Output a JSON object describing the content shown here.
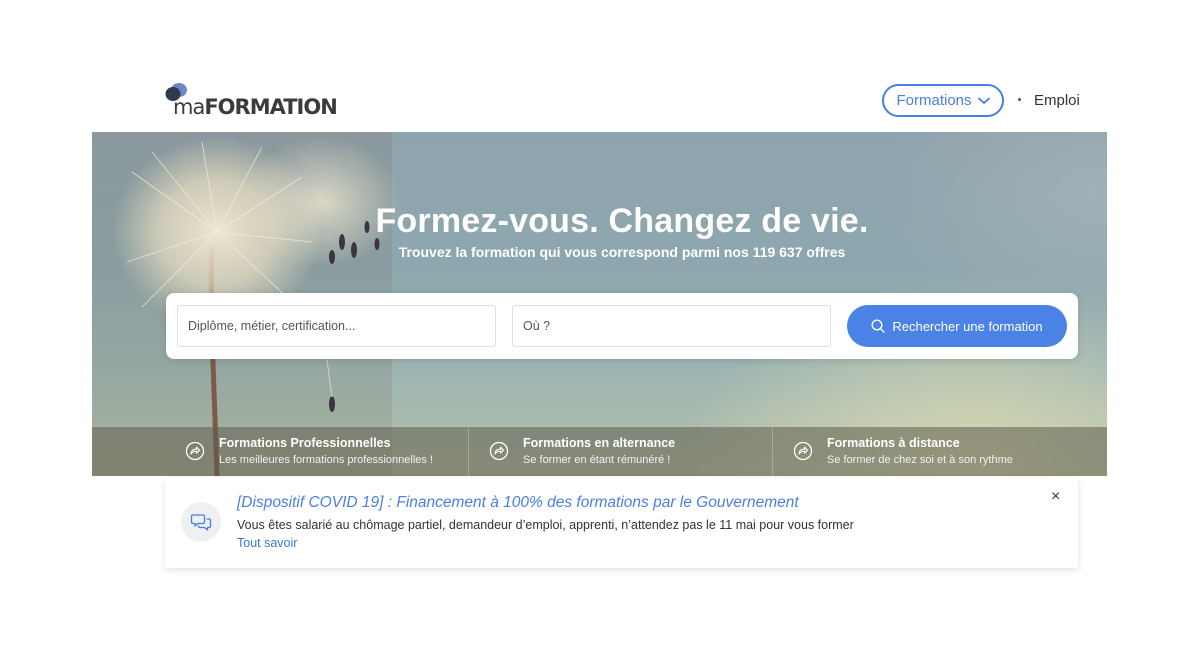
{
  "header": {
    "logo": {
      "prefix": "ma",
      "word": "FORMATION"
    },
    "nav": {
      "formations_label": "Formations",
      "emploi_label": "Emploi"
    }
  },
  "hero": {
    "title": "Formez-vous. Changez de vie.",
    "subtitle": "Trouvez la formation qui vous correspond parmi nos 119 637 offres"
  },
  "search": {
    "what_placeholder": "Diplôme, métier, certification...",
    "where_placeholder": "Où ?",
    "button_label": "Rechercher une formation",
    "button_color": "#4a82e6"
  },
  "categories": [
    {
      "title": "Formations Professionnelles",
      "subtitle": "Les meilleures formations professionnelles !",
      "icon": "share-arrow-icon"
    },
    {
      "title": "Formations en alternance",
      "subtitle": "Se former en étant rémunéré !",
      "icon": "share-arrow-icon"
    },
    {
      "title": "Formations à distance",
      "subtitle": "Se former de chez soi et à son rythme",
      "icon": "share-arrow-icon"
    }
  ],
  "notice": {
    "title": "[Dispositif COVID 19] : Financement à 100% des formations par le Gouvernement",
    "text": "Vous êtes salarié au chômage partiel, demandeur d’emploi, apprenti, n’attendez pas le 11 mai pour vous former",
    "link_label": "Tout savoir",
    "close_label": "×",
    "icon": "chat-bubbles-icon"
  },
  "colors": {
    "accent": "#4a7fe0",
    "logo_dark": "#2f3a4f",
    "logo_blue": "#6c86c8"
  }
}
